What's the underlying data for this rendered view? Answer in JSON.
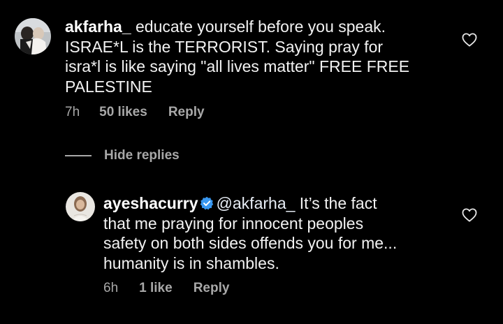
{
  "comment": {
    "username": "akfarha_",
    "text_line1": " educate yourself before you speak.",
    "text_line2": "ISRAE*L is the TERRORIST. Saying pray for",
    "text_line3": "isra*l is like saying \"all lives matter\" FREE FREE",
    "text_line4": "PALESTINE",
    "time": "7h",
    "likes": "50 likes",
    "reply_label": "Reply",
    "like_icon": "heart-outline-icon"
  },
  "replies_toggle": {
    "label": "Hide replies"
  },
  "reply": {
    "username": "ayeshacurry",
    "verified_icon": "verified-badge-icon",
    "mention": "@akfarha_",
    "text_line1_rest": "  It’s the fact",
    "text_line2": "that me praying for innocent peoples",
    "text_line3": "safety on both sides offends you for me...",
    "text_line4": "humanity is in shambles.",
    "time": "6h",
    "likes": "1 like",
    "reply_label": "Reply",
    "like_icon": "heart-outline-icon"
  },
  "colors": {
    "background": "#000000",
    "primary_text": "#f2f2f2",
    "secondary_text": "#a8a8a8",
    "verified_blue": "#3897f0"
  }
}
